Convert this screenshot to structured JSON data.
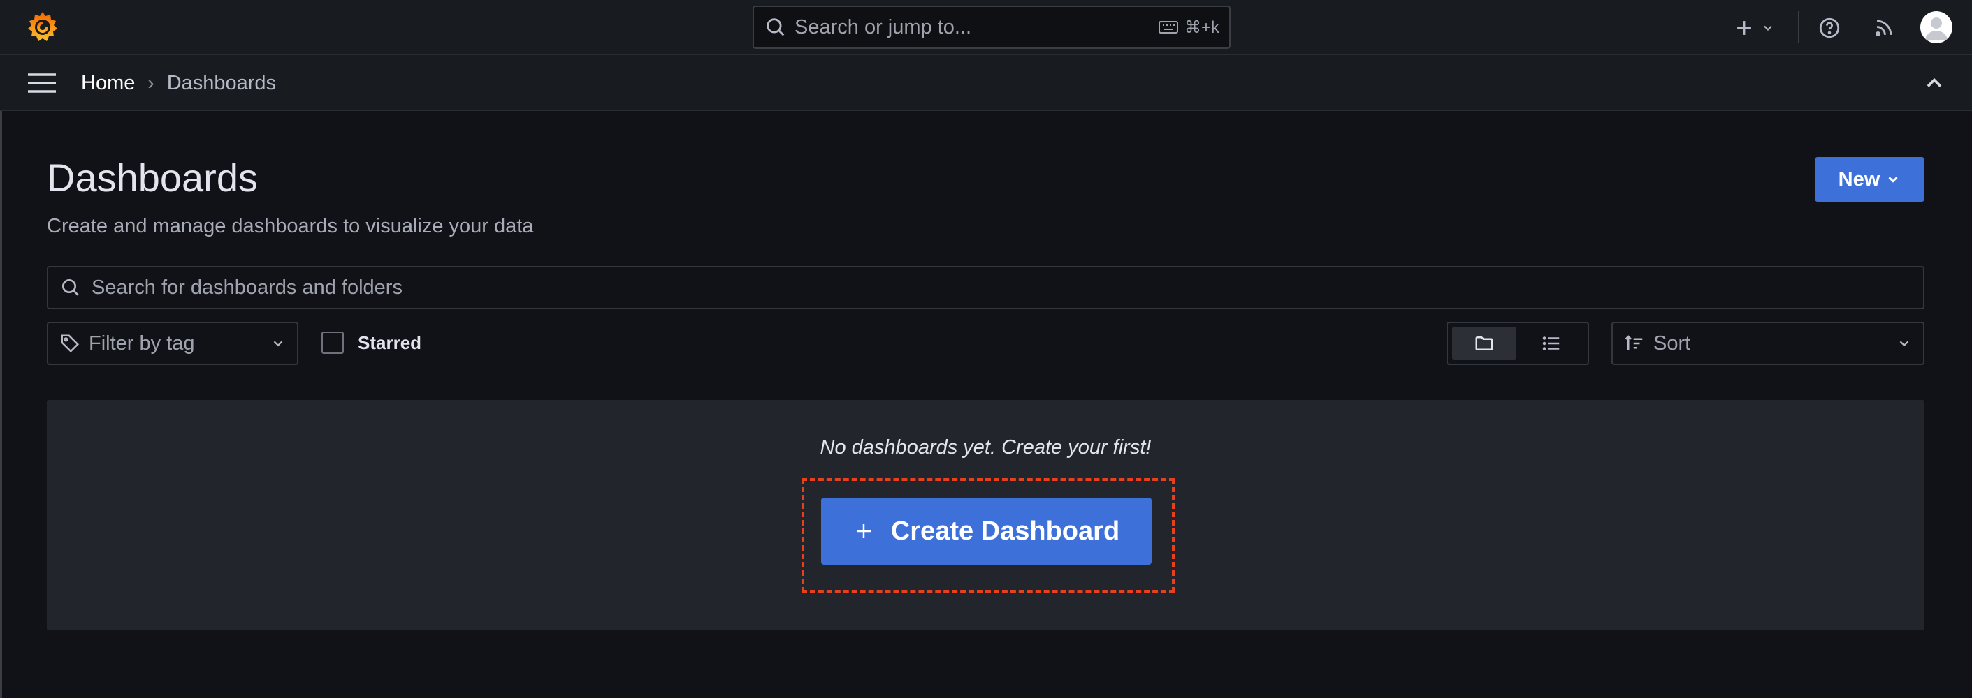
{
  "topbar": {
    "search_placeholder": "Search or jump to...",
    "shortcut": "⌘+k",
    "icons": [
      "grafana-logo-icon",
      "plus-icon",
      "chevron-down-icon",
      "help-icon",
      "rss-icon",
      "user-avatar-icon"
    ]
  },
  "breadcrumb": {
    "home": "Home",
    "separator": "›",
    "current": "Dashboards"
  },
  "page": {
    "title": "Dashboards",
    "subtitle": "Create and manage dashboards to visualize your data",
    "new_label": "New"
  },
  "search": {
    "placeholder": "Search for dashboards and folders"
  },
  "filters": {
    "tag_label": "Filter by tag",
    "starred_label": "Starred",
    "starred_checked": false,
    "view_mode": "folders",
    "sort_label": "Sort"
  },
  "empty_state": {
    "message": "No dashboards yet. Create your first!",
    "create_label": "Create Dashboard"
  },
  "colors": {
    "background": "#111217",
    "panel": "#181b1f",
    "primary": "#3d71d9",
    "highlight": "#e8401c",
    "logo_orange": "#f46800",
    "logo_yellow": "#fbc02d"
  }
}
